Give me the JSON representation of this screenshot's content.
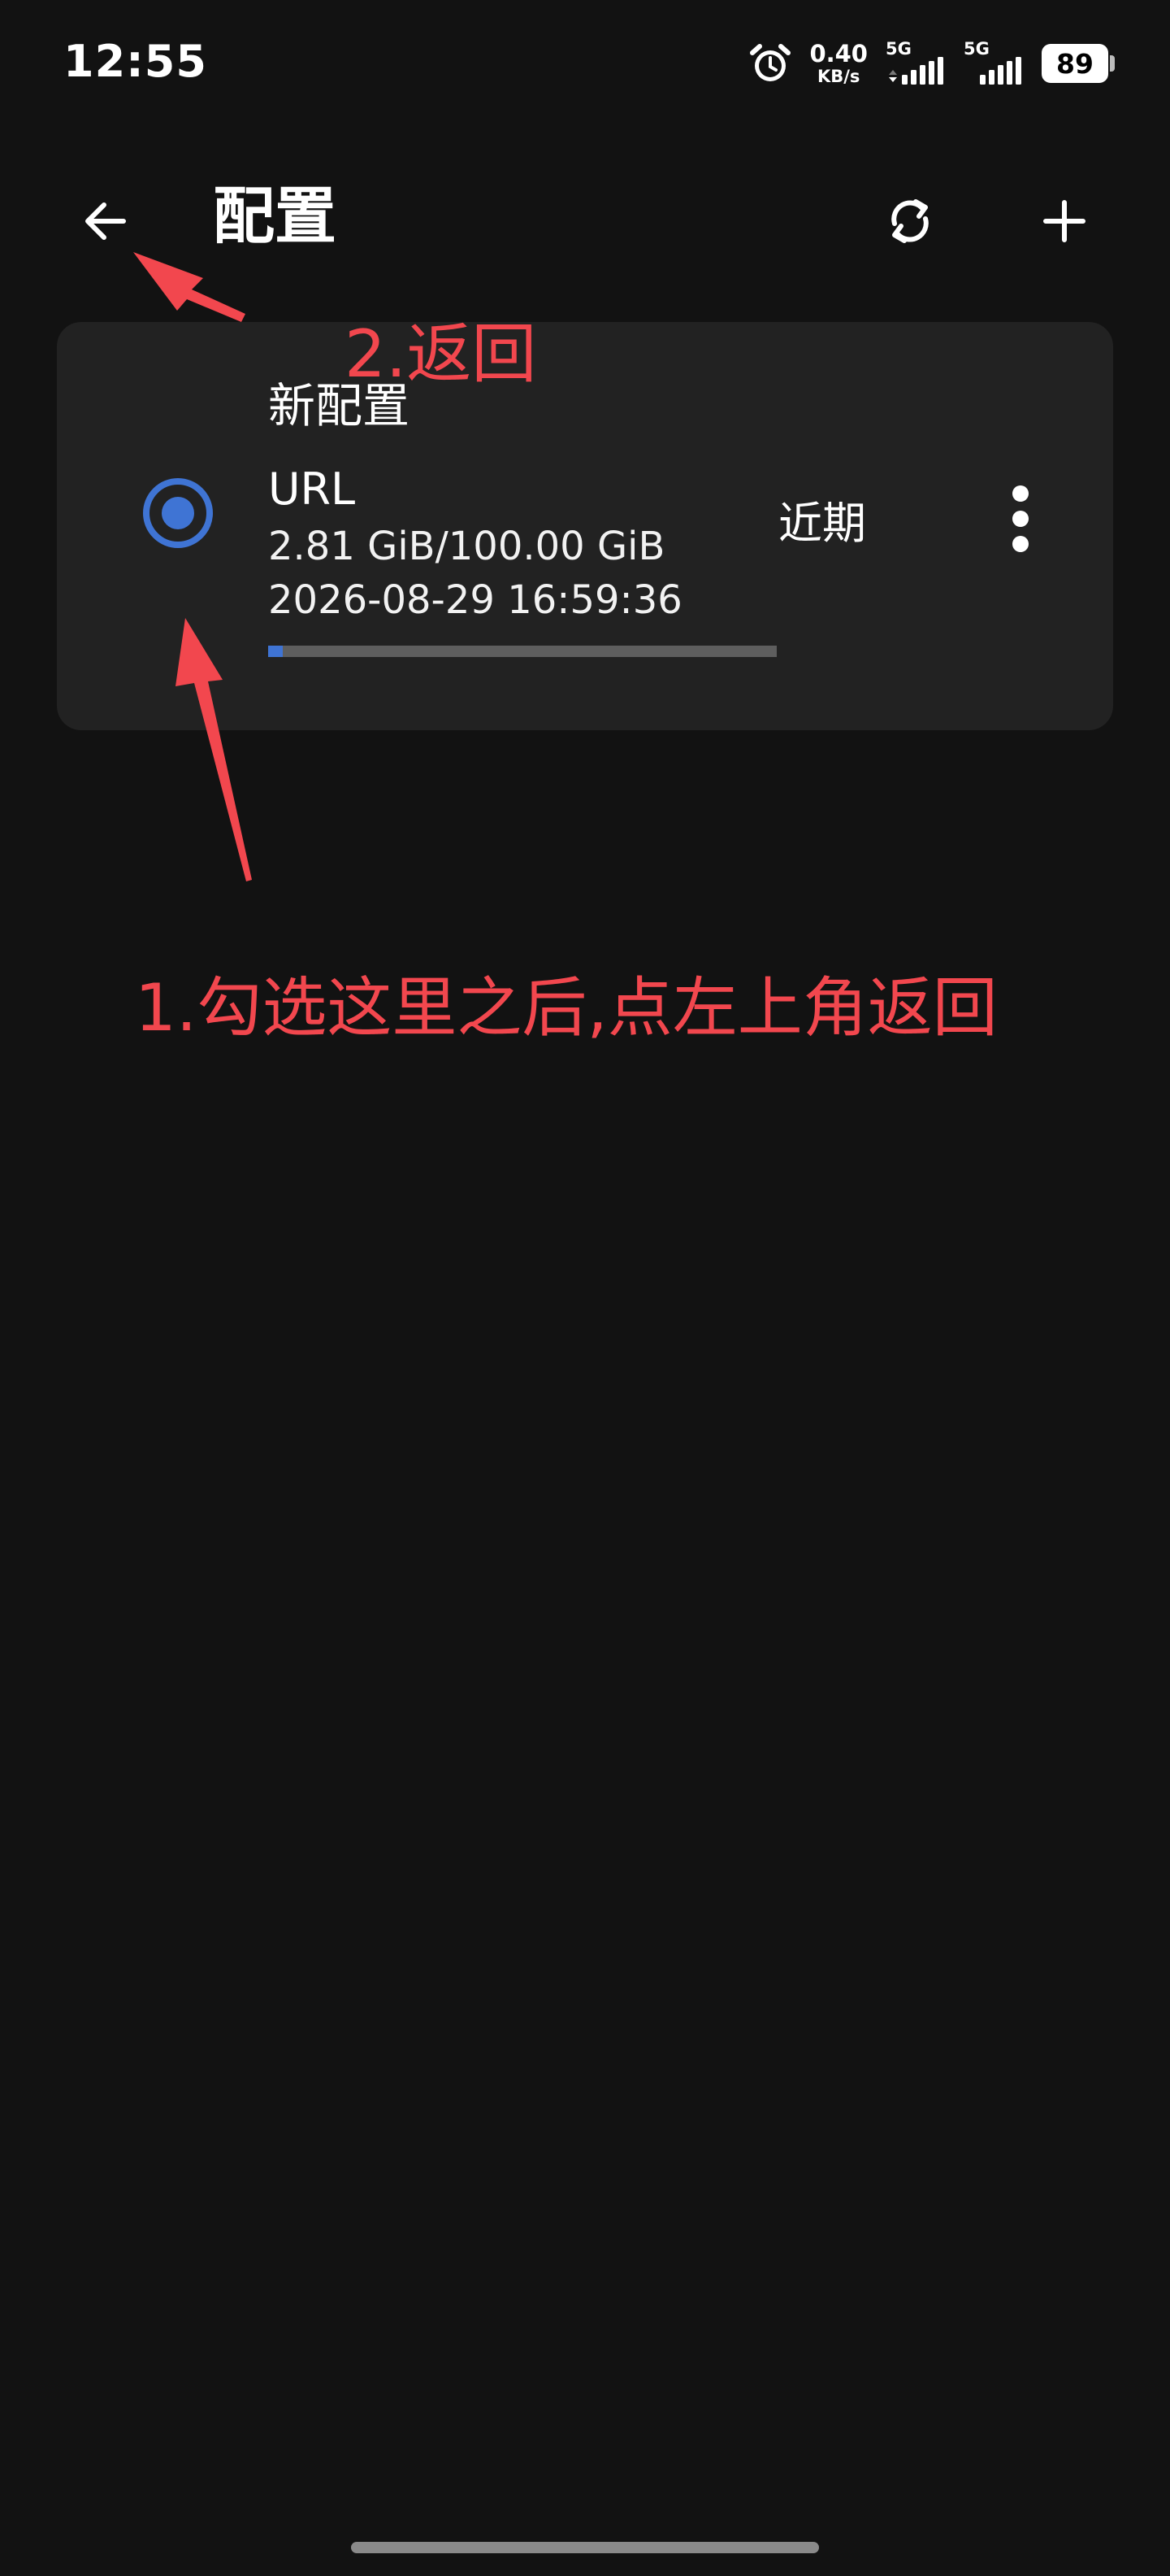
{
  "status_bar": {
    "time": "12:55",
    "net_speed_value": "0.40",
    "net_speed_unit": "KB/s",
    "sim1_label": "5G",
    "sim2_label": "5G",
    "battery_level": "89",
    "icons": [
      "alarm-icon",
      "signal-icon",
      "signal-icon",
      "battery-icon"
    ]
  },
  "app_bar": {
    "title": "配置",
    "icons": [
      "arrow-left-icon",
      "refresh-icon",
      "plus-icon"
    ]
  },
  "profile": {
    "name": "新配置",
    "type": "URL",
    "usage": "2.81 GiB/100.00 GiB",
    "usage_fraction": 0.028,
    "expire": "2026-08-29 16:59:36",
    "recent_label": "近期",
    "selected": true,
    "icons": [
      "radio-selected-icon",
      "more-vertical-icon"
    ]
  },
  "annotations": {
    "back_hint": "2.返回",
    "instruction": "1.勾选这里之后,点左上角返回"
  },
  "colors": {
    "background": "#121212",
    "card": "#222222",
    "accent": "#3f74d4",
    "annotation": "#f2474e"
  }
}
